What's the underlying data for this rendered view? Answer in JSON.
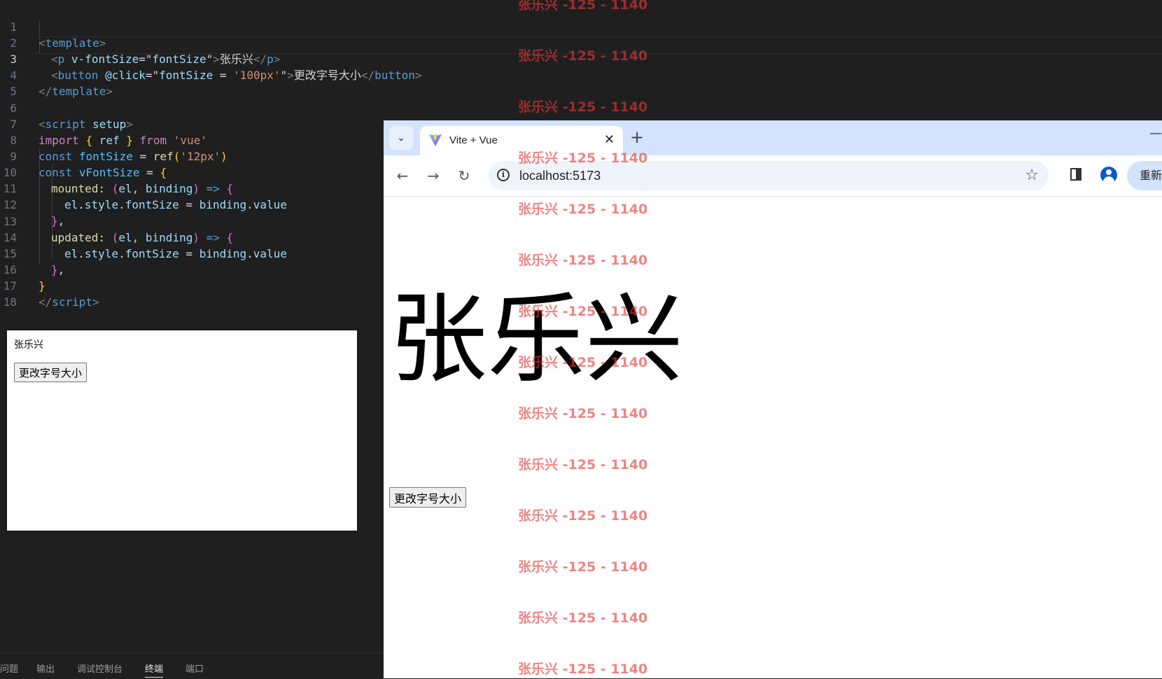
{
  "editor": {
    "lines": [
      {
        "n": "1"
      },
      {
        "n": "2"
      },
      {
        "n": "3"
      },
      {
        "n": "4"
      },
      {
        "n": "5"
      },
      {
        "n": "6"
      },
      {
        "n": "7"
      },
      {
        "n": "8"
      },
      {
        "n": "9"
      },
      {
        "n": "10"
      },
      {
        "n": "11"
      },
      {
        "n": "12"
      },
      {
        "n": "13"
      },
      {
        "n": "14"
      },
      {
        "n": "15"
      },
      {
        "n": "16"
      },
      {
        "n": "17"
      },
      {
        "n": "18"
      }
    ],
    "active_line": "3",
    "tokens": {
      "l1": [
        "<",
        "template",
        ">"
      ],
      "l2": [
        "<",
        "p",
        "v-fontSize",
        "=\"",
        "fontSize",
        "\"",
        ">",
        "张乐兴",
        "</",
        "p",
        ">"
      ],
      "l3": [
        "<",
        "button",
        "@click",
        "=\"",
        "fontSize",
        " = ",
        "'100px'",
        "\"",
        ">",
        "更改字号大小",
        "</",
        "button",
        ">"
      ],
      "l4": [
        "</",
        "template",
        ">"
      ],
      "l6": [
        "<",
        "script",
        "setup",
        ">"
      ],
      "l7": [
        "import",
        "{",
        "ref",
        "}",
        "from",
        "'vue'"
      ],
      "l8": [
        "const",
        "fontSize",
        "=",
        "ref",
        "(",
        "'12px'",
        ")"
      ],
      "l9": [
        "const",
        "vFontSize",
        "=",
        "{"
      ],
      "l10": [
        "mounted",
        ":",
        "(",
        "el",
        ",",
        "binding",
        ")",
        "=>",
        "{"
      ],
      "l11": [
        "el",
        ".",
        "style",
        ".",
        "fontSize",
        "=",
        "binding",
        ".",
        "value"
      ],
      "l12": [
        "}",
        ","
      ],
      "l13": [
        "updated",
        ":",
        "(",
        "el",
        ",",
        "binding",
        ")",
        "=>",
        "{"
      ],
      "l14": [
        "el",
        ".",
        "style",
        ".",
        "fontSize",
        "=",
        "binding",
        ".",
        "value"
      ],
      "l15": [
        "}",
        ","
      ],
      "l16": [
        "}"
      ],
      "l17": [
        "</",
        "script",
        ">"
      ]
    }
  },
  "preview": {
    "text": "张乐兴",
    "button_label": "更改字号大小"
  },
  "panel": {
    "tabs": [
      "问题",
      "输出",
      "调试控制台",
      "终端",
      "端口"
    ],
    "active_tab": "终端"
  },
  "browser": {
    "tab_title": "Vite + Vue",
    "url": "localhost:5173",
    "relaunch_label": "重新",
    "page_text": "张乐兴",
    "page_button_label": "更改字号大小"
  },
  "watermark": {
    "text": "张乐兴 -125 - 1140",
    "count": 14
  },
  "colors": {
    "editor_bg": "#1f1f1f",
    "tabstrip_bg": "#d3e3fd",
    "watermark": "#e53935"
  },
  "icons": [
    "tab-search-icon",
    "vite-logo-icon",
    "close-icon",
    "plus-icon",
    "minimize-icon",
    "back-arrow-icon",
    "forward-arrow-icon",
    "reload-icon",
    "site-info-icon",
    "star-icon",
    "side-panel-icon",
    "profile-icon"
  ]
}
